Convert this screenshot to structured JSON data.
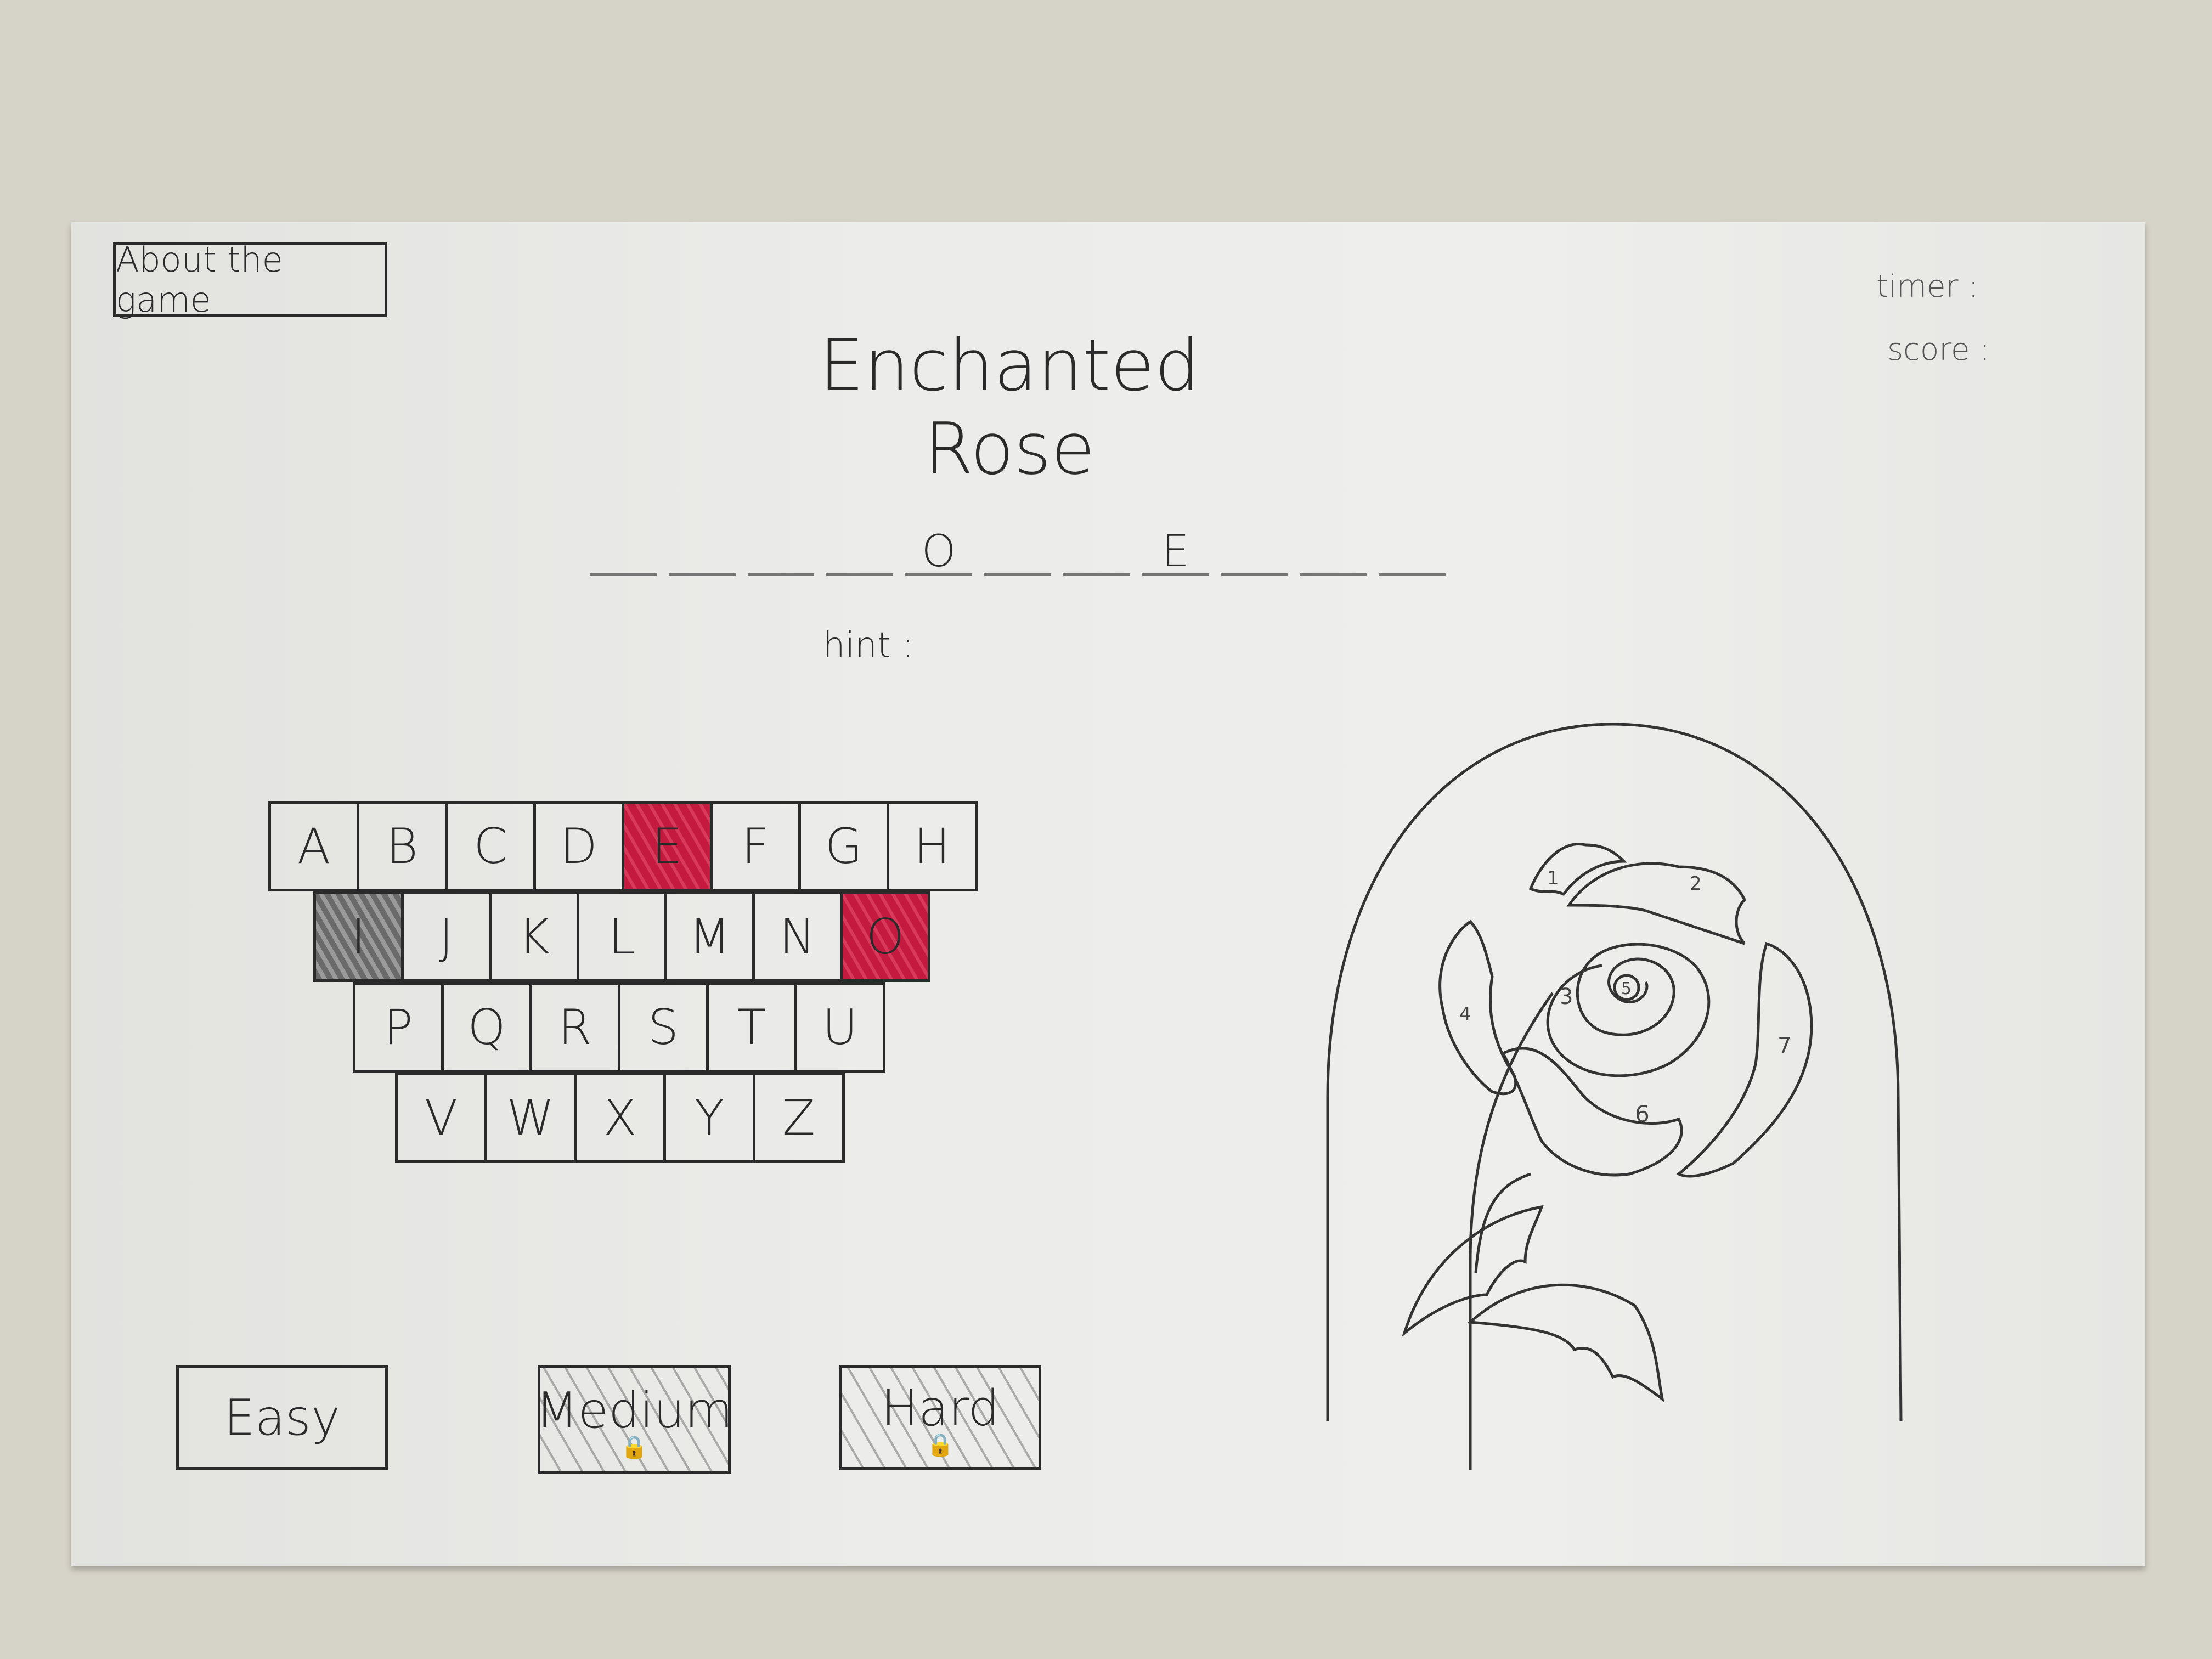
{
  "header": {
    "about_button": "About the game",
    "title": "Enchanted Rose",
    "timer_label": "timer :",
    "score_label": "score :"
  },
  "puzzle": {
    "slots": [
      "",
      "",
      "",
      "",
      "O",
      "",
      "",
      "E",
      "",
      "",
      ""
    ],
    "hint_label": "hint :"
  },
  "keyboard": {
    "rows": [
      [
        "A",
        "B",
        "C",
        "D",
        "E",
        "F",
        "G",
        "H"
      ],
      [
        "I",
        "J",
        "K",
        "L",
        "M",
        "N",
        "O"
      ],
      [
        "P",
        "Q",
        "R",
        "S",
        "T",
        "U"
      ],
      [
        "V",
        "W",
        "X",
        "Y",
        "Z"
      ]
    ],
    "correct_keys": [
      "E",
      "O"
    ],
    "wrong_keys": [
      "I"
    ],
    "correct_color": "#c41a40",
    "wrong_color": "#777777"
  },
  "levels": [
    {
      "label": "Easy",
      "locked": false
    },
    {
      "label": "Medium",
      "locked": true
    },
    {
      "label": "Hard",
      "locked": true
    }
  ],
  "rose": {
    "petal_numbers": [
      "1",
      "2",
      "3",
      "4",
      "5",
      "6",
      "7"
    ]
  }
}
